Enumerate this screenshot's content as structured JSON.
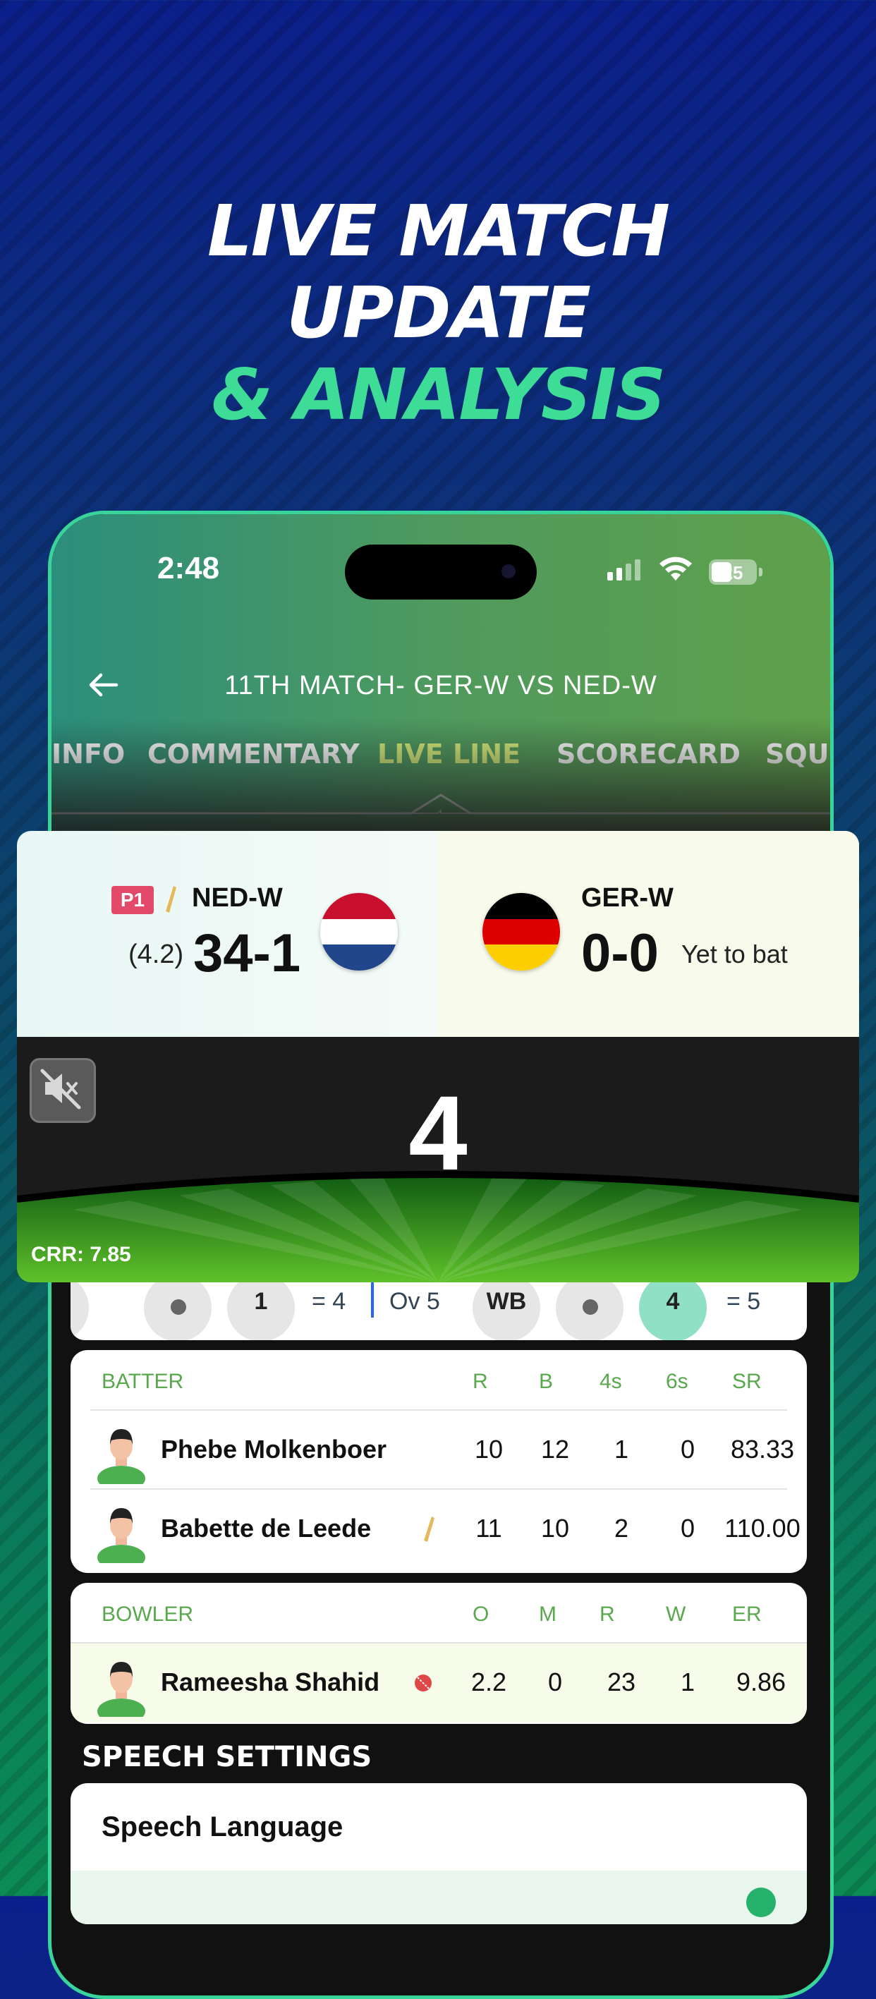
{
  "headline": {
    "line1": "LIVE MATCH",
    "line2": "UPDATE",
    "line3": "& ANALYSIS"
  },
  "status_bar": {
    "time": "2:48",
    "battery": "25"
  },
  "header": {
    "title": "11TH MATCH- GER-W VS NED-W"
  },
  "tabs": [
    {
      "label": "INFO"
    },
    {
      "label": "COMMENTARY"
    },
    {
      "label": "LIVE LINE"
    },
    {
      "label": "SCORECARD"
    },
    {
      "label": "SQU"
    }
  ],
  "score": {
    "innings_badge": "P1",
    "team_left": "NED-W",
    "overs_left": "(4.2)",
    "score_left": "34-1",
    "team_right": "GER-W",
    "score_right": "0-0",
    "status_right": "Yet to bat"
  },
  "live": {
    "last_ball": "4",
    "crr": "CRR: 7.85"
  },
  "over_strip": {
    "ball_1": "1",
    "total_1": "= 4",
    "over_label": "Ov 5",
    "ball_wb": "WB",
    "ball_4": "4",
    "total_2": "= 5"
  },
  "batters": {
    "headers": [
      "BATTER",
      "R",
      "B",
      "4s",
      "6s",
      "SR"
    ],
    "rows": [
      {
        "name": "Phebe Molkenboer",
        "r": "10",
        "b": "12",
        "fours": "1",
        "sixes": "0",
        "sr": "83.33"
      },
      {
        "name": "Babette de Leede",
        "r": "11",
        "b": "10",
        "fours": "2",
        "sixes": "0",
        "sr": "110.00"
      }
    ]
  },
  "bowlers": {
    "headers": [
      "BOWLER",
      "O",
      "M",
      "R",
      "W",
      "ER"
    ],
    "rows": [
      {
        "name": "Rameesha Shahid",
        "o": "2.2",
        "m": "0",
        "r": "23",
        "w": "1",
        "er": "9.86"
      }
    ]
  },
  "speech": {
    "section_title": "SPEECH SETTINGS",
    "language_label": "Speech Language"
  },
  "colors": {
    "accent": "#3ddc97",
    "active_tab": "#d8f07a",
    "header_green": "#5aa84e",
    "badge": "#e34a6a"
  }
}
